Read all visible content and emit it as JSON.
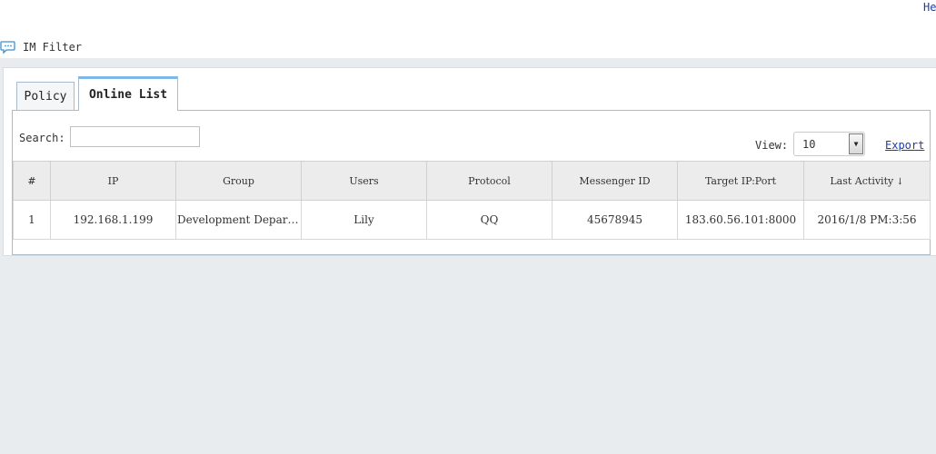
{
  "header": {
    "help_label": "Help"
  },
  "module": {
    "title": "IM Filter",
    "icon": "chat-bubble-icon"
  },
  "tabs": [
    {
      "label": "Policy",
      "active": false
    },
    {
      "label": "Online List",
      "active": true
    }
  ],
  "toolbar": {
    "search_label": "Search:",
    "search_value": "",
    "view_label": "View:",
    "view_value": "10",
    "export_label": "Export"
  },
  "table": {
    "columns": [
      "#",
      "IP",
      "Group",
      "Users",
      "Protocol",
      "Messenger ID",
      "Target IP:Port",
      "Last Activity"
    ],
    "sort_indicator": "↓",
    "rows": [
      [
        "1",
        "192.168.1.199",
        "Development Department",
        "Lily",
        "QQ",
        "45678945",
        "183.60.56.101:8000",
        "2016/1/8 PM:3:56"
      ]
    ]
  },
  "colors": {
    "accent": "#7fb7e6",
    "link": "#1a3cb8",
    "background_gray": "#e9ecef"
  }
}
